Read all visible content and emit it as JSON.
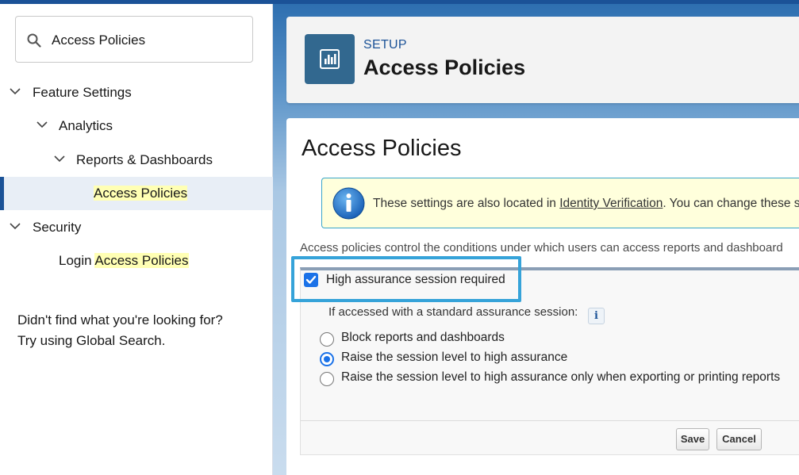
{
  "sidebar": {
    "search_value": "Access Policies",
    "tree": [
      {
        "label": "Feature Settings",
        "match": ""
      },
      {
        "label": "Analytics",
        "match": ""
      },
      {
        "label": "Reports & Dashboards",
        "match": ""
      },
      {
        "label": "",
        "match": "Access Policies"
      },
      {
        "label": "Security",
        "match": ""
      },
      {
        "label": "Login ",
        "match": "Access Policies"
      }
    ],
    "not_found_line1": "Didn't find what you're looking for?",
    "not_found_line2": "Try using Global Search."
  },
  "header": {
    "eyebrow": "SETUP",
    "title": "Access Policies",
    "icon": "chart-icon"
  },
  "content": {
    "page_title": "Access Policies",
    "info_text_before": "These settings are also located in ",
    "info_link": "Identity Verification",
    "info_text_after": ". You can change these s",
    "description": "Access policies control the conditions under which users can access reports and dashboard",
    "checkbox_label": "High assurance session required",
    "checkbox_checked": true,
    "sub_label": "If accessed with a standard assurance session:",
    "help_icon_glyph": "i",
    "radio_options": [
      {
        "label": "Block reports and dashboards",
        "checked": false
      },
      {
        "label": "Raise the session level to high assurance",
        "checked": true
      },
      {
        "label": "Raise the session level to high assurance only when exporting or printing reports",
        "checked": false
      }
    ],
    "save_label": "Save",
    "cancel_label": "Cancel"
  },
  "colors": {
    "brand_blue": "#1b5297",
    "highlight_yellow": "#ffffb4",
    "callout_border": "#36a3d9",
    "checkbox_blue": "#1b72e8"
  }
}
